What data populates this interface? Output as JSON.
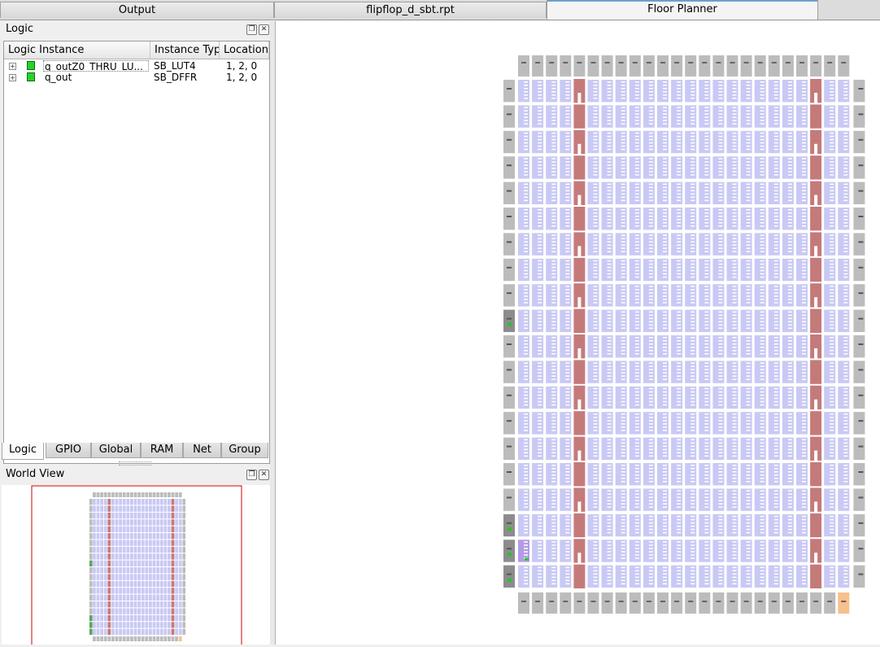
{
  "tabs": [
    {
      "label": "Output",
      "active": false
    },
    {
      "label": "flipflop_d_sbt.rpt",
      "active": false
    },
    {
      "label": "Floor Planner",
      "active": true
    }
  ],
  "logic_panel": {
    "title": "Logic",
    "columns": [
      "Logic Instance",
      "Instance Typ",
      "Location"
    ],
    "rows": [
      {
        "expander": "+",
        "icon": "logic-cell-icon",
        "instance": "q_outZ0_THRU_LU...",
        "type": "SB_LUT4",
        "location": "1,  2, 0"
      },
      {
        "expander": "+",
        "icon": "logic-cell-icon",
        "instance": "q_out",
        "type": "SB_DFFR",
        "location": "1,  2, 0"
      }
    ],
    "bottom_tabs": [
      "Logic",
      "GPIO",
      "Global",
      "RAM",
      "Net",
      "Group"
    ],
    "active_bottom_tab": "Logic"
  },
  "world_view": {
    "title": "World View"
  },
  "icons": {
    "float": "float-icon",
    "close": "close-icon"
  },
  "colors": {
    "logic_tile": "#c9c9f5",
    "io_tile": "#bcbcbc",
    "ram_tile": "#c57a7a",
    "used_io": "#27c427",
    "pll_tile": "#f7c08c",
    "selection_rect": "#cc0000"
  }
}
